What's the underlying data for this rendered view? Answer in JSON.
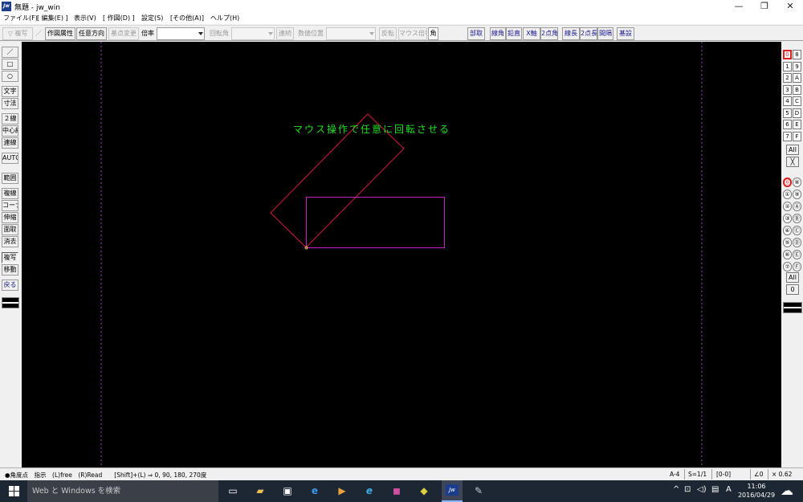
{
  "window": {
    "title": "無題 - jw_win",
    "icon": "Jw",
    "minimize": "—",
    "maximize": "❐",
    "close": "✕"
  },
  "menu": [
    "ファイル(F)",
    "[ 編集(E) ]",
    "表示(V)",
    "[ 作図(D) ]",
    "設定(S)",
    "[その他(A)]",
    "ヘルプ(H)"
  ],
  "toolbar": {
    "fukusha": "▽ 複写",
    "slash": "／",
    "sakuzu_zokusei": "作図属性",
    "nini_hoko": "任意方向",
    "kiten_henko": "基点変更",
    "bairitsu": "倍率",
    "kaitenkaku": "回転角",
    "renzoku": "連続",
    "suuchi_ichi": "数値位置",
    "hanten": "反転",
    "mouse_bairitsu": "マウス倍率",
    "kaku": "角",
    "buttons": [
      "部取",
      "線角",
      "鉛直",
      "X軸",
      "2点角",
      "線長",
      "2点長",
      "間隔",
      "基設"
    ]
  },
  "left_tools": [
    "／",
    "□",
    "○",
    "文字",
    "寸法",
    "２線",
    "中心線",
    "連線",
    "AUTO",
    "範囲",
    "複線",
    "コーナー",
    "伸縮",
    "面取",
    "消去",
    "複写",
    "移動",
    "戻る"
  ],
  "right_panel": {
    "group_rows": [
      [
        "0",
        "8"
      ],
      [
        "1",
        "9"
      ],
      [
        "2",
        "A"
      ],
      [
        "3",
        "B"
      ],
      [
        "4",
        "C"
      ],
      [
        "5",
        "D"
      ],
      [
        "6",
        "E"
      ],
      [
        "7",
        "F"
      ]
    ],
    "all_label": "All",
    "x_label": "╳",
    "layer_rows": [
      [
        "⓪",
        "⑧"
      ],
      [
        "①",
        "⑨"
      ],
      [
        "②",
        "Ⓐ"
      ],
      [
        "③",
        "Ⓑ"
      ],
      [
        "④",
        "Ⓒ"
      ],
      [
        "⑤",
        "Ⓓ"
      ],
      [
        "⑥",
        "Ⓔ"
      ],
      [
        "⑦",
        "Ⓕ"
      ]
    ],
    "all_label_2": "All",
    "zero_label": "0"
  },
  "canvas": {
    "caption": "マウス操作で任意に回転させる",
    "caption_color": "#1fe01f",
    "rotated_rect_color": "#d4163c",
    "rect_color": "#c41ec4",
    "frame_color": "#a040c0",
    "background": "#000000"
  },
  "status": {
    "left": "●角度点　指示　(L)free　(R)Read　　[Shift]+(L) ⇒ 0, 90, 180, 270度",
    "paper": "A-4",
    "scale": "S=1/1",
    "layer": "[0-0]",
    "angle": "∠0",
    "zoom": "× 0.62"
  },
  "taskbar": {
    "search_placeholder": "Web と Windows を検索",
    "ime": "A",
    "time": "11:06",
    "date": "2016/04/29"
  }
}
